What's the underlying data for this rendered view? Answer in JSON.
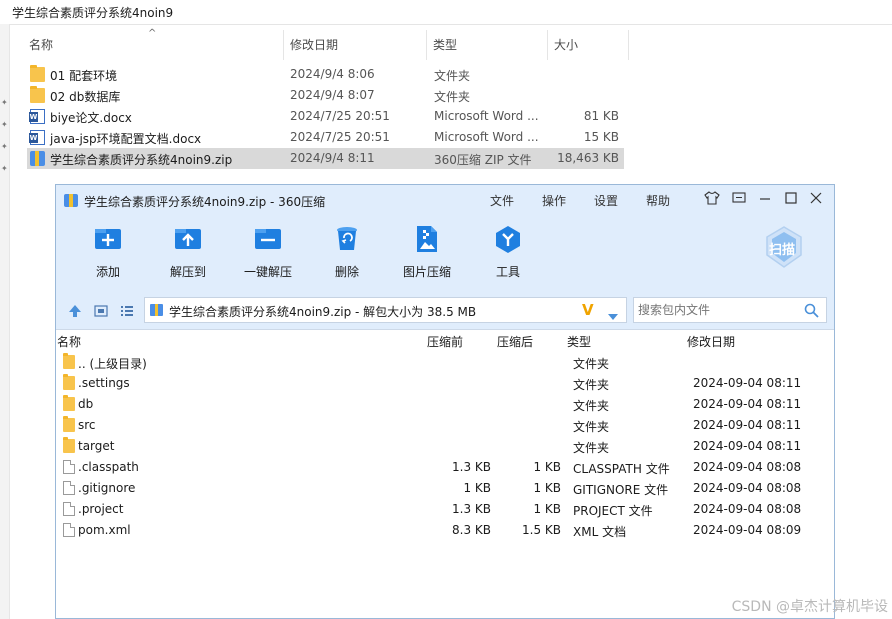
{
  "explorer": {
    "address": "学生综合素质评分系统4noin9",
    "columns": {
      "name": "名称",
      "modified": "修改日期",
      "type": "类型",
      "size": "大小"
    },
    "rows": [
      {
        "name": "01 配套环境",
        "modified": "2024/9/4 8:06",
        "type": "文件夹",
        "size": "",
        "icon": "folder-icon"
      },
      {
        "name": "02 db数据库",
        "modified": "2024/9/4 8:07",
        "type": "文件夹",
        "size": "",
        "icon": "folder-icon"
      },
      {
        "name": "biye论文.docx",
        "modified": "2024/7/25 20:51",
        "type": "Microsoft Word ...",
        "size": "81 KB",
        "icon": "word-doc-icon"
      },
      {
        "name": "java-jsp环境配置文档.docx",
        "modified": "2024/7/25 20:51",
        "type": "Microsoft Word ...",
        "size": "15 KB",
        "icon": "word-doc-icon"
      },
      {
        "name": "学生综合素质评分系统4noin9.zip",
        "modified": "2024/9/4 8:11",
        "type": "360压缩 ZIP 文件",
        "size": "18,463 KB",
        "icon": "zip-archive-icon",
        "selected": true
      }
    ]
  },
  "zipwin": {
    "title": "学生综合素质评分系统4noin9.zip - 360压缩",
    "menu": [
      "文件",
      "操作",
      "设置",
      "帮助"
    ],
    "toolbar": [
      {
        "label": "添加",
        "icon": "add-icon"
      },
      {
        "label": "解压到",
        "icon": "extract-to-icon"
      },
      {
        "label": "一键解压",
        "icon": "one-click-extract-icon"
      },
      {
        "label": "删除",
        "icon": "delete-icon"
      },
      {
        "label": "图片压缩",
        "icon": "image-compress-icon"
      },
      {
        "label": "工具",
        "icon": "tools-icon"
      }
    ],
    "scan_label": "扫描",
    "address": "学生综合素质评分系统4noin9.zip - 解包大小为 38.5 MB",
    "search_placeholder": "搜索包内文件",
    "columns": {
      "name": "名称",
      "packed": "压缩前",
      "unpacked": "压缩后",
      "type": "类型",
      "modified": "修改日期"
    },
    "rows": [
      {
        "name": ".. (上级目录)",
        "pre": "",
        "post": "",
        "type": "文件夹",
        "modified": "",
        "icon": "folder"
      },
      {
        "name": ".settings",
        "pre": "",
        "post": "",
        "type": "文件夹",
        "modified": "2024-09-04 08:11",
        "icon": "folder"
      },
      {
        "name": "db",
        "pre": "",
        "post": "",
        "type": "文件夹",
        "modified": "2024-09-04 08:11",
        "icon": "folder"
      },
      {
        "name": "src",
        "pre": "",
        "post": "",
        "type": "文件夹",
        "modified": "2024-09-04 08:11",
        "icon": "folder"
      },
      {
        "name": "target",
        "pre": "",
        "post": "",
        "type": "文件夹",
        "modified": "2024-09-04 08:11",
        "icon": "folder"
      },
      {
        "name": ".classpath",
        "pre": "1.3 KB",
        "post": "1 KB",
        "type": "CLASSPATH 文件",
        "modified": "2024-09-04 08:08",
        "icon": "file"
      },
      {
        "name": ".gitignore",
        "pre": "1 KB",
        "post": "1 KB",
        "type": "GITIGNORE 文件",
        "modified": "2024-09-04 08:08",
        "icon": "file"
      },
      {
        "name": ".project",
        "pre": "1.3 KB",
        "post": "1 KB",
        "type": "PROJECT 文件",
        "modified": "2024-09-04 08:08",
        "icon": "file"
      },
      {
        "name": "pom.xml",
        "pre": "8.3 KB",
        "post": "1.5 KB",
        "type": "XML 文档",
        "modified": "2024-09-04 08:09",
        "icon": "file"
      }
    ]
  },
  "watermark": "CSDN @卓杰计算机毕设",
  "colors": {
    "toolbar_bg": "#e0edfc",
    "icon_blue": "#1f7fe0",
    "selected_row": "#d9d9d9",
    "folder": "#f8c44c"
  }
}
